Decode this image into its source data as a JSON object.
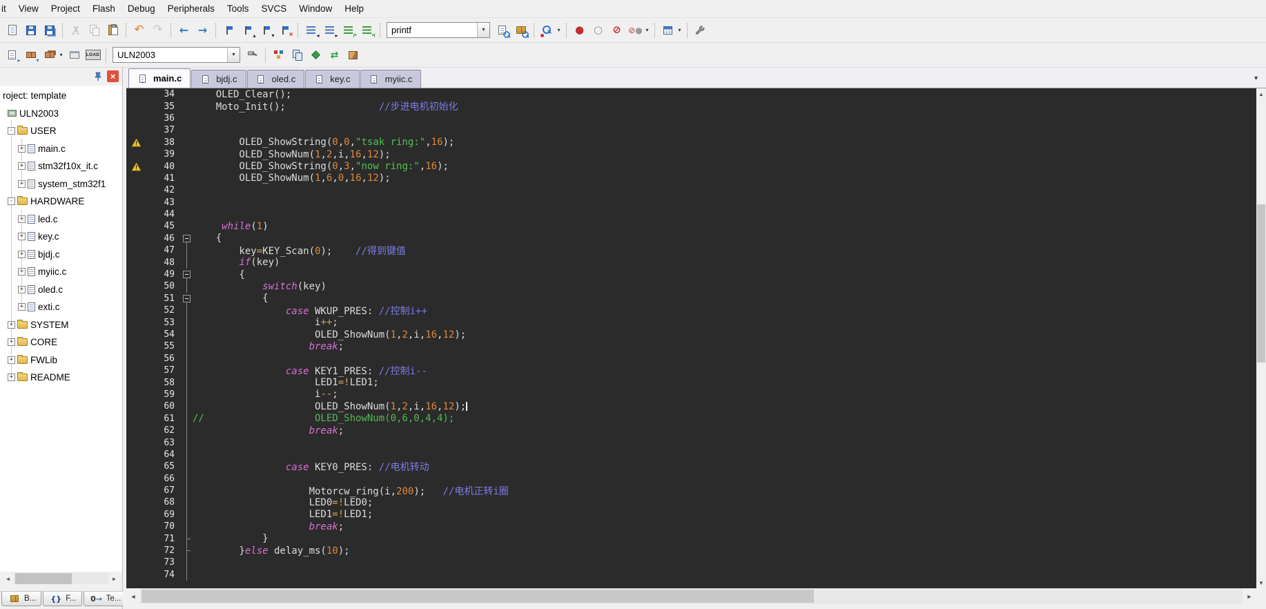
{
  "colors": {
    "edbg": "#2B2B2B",
    "fg": "#DCDCDC",
    "kw": "#D76FD7",
    "num": "#DE8A3D",
    "str": "#4EC34E",
    "cmtb": "#7B7BE8",
    "cmtg": "#55B855",
    "op": "#CFA75A",
    "ln": "#E6E6E6",
    "bp-red": "#C03030",
    "accent": "#2E6FD0",
    "tab-inactive": "#C9C9DE",
    "warning": "#F5C51D"
  },
  "menu_bar": {
    "items": [
      "it",
      "View",
      "Project",
      "Flash",
      "Debug",
      "Peripherals",
      "Tools",
      "SVCS",
      "Window",
      "Help"
    ]
  },
  "toolbar_main": {
    "find_value": "printf",
    "items": [
      {
        "t": "btn",
        "n": "new-file"
      },
      {
        "t": "btn",
        "n": "save"
      },
      {
        "t": "btn",
        "n": "save-all"
      },
      {
        "t": "sep"
      },
      {
        "t": "btn",
        "n": "cut",
        "dis": true
      },
      {
        "t": "btn",
        "n": "copy",
        "dis": true
      },
      {
        "t": "btn",
        "n": "paste"
      },
      {
        "t": "sep"
      },
      {
        "t": "btn",
        "n": "undo"
      },
      {
        "t": "btn",
        "n": "redo",
        "dis": true
      },
      {
        "t": "sep"
      },
      {
        "t": "btn",
        "n": "nav-back"
      },
      {
        "t": "btn",
        "n": "nav-forward"
      },
      {
        "t": "sep"
      },
      {
        "t": "btn",
        "n": "bookmark-toggle"
      },
      {
        "t": "btn",
        "n": "bookmark-prev"
      },
      {
        "t": "btn",
        "n": "bookmark-next"
      },
      {
        "t": "btn",
        "n": "bookmark-clear-all"
      },
      {
        "t": "sep"
      },
      {
        "t": "btn",
        "n": "unindent"
      },
      {
        "t": "btn",
        "n": "indent"
      },
      {
        "t": "btn",
        "n": "comment-selection"
      },
      {
        "t": "btn",
        "n": "uncomment-selection"
      },
      {
        "t": "sep"
      },
      {
        "t": "combo",
        "n": "find",
        "bind": "toolbar_main.find_value",
        "w": 150
      },
      {
        "t": "btn",
        "n": "find-in-files"
      },
      {
        "t": "btn",
        "n": "search-books"
      },
      {
        "t": "sep"
      },
      {
        "t": "btn",
        "n": "incremental-find",
        "drop": true
      },
      {
        "t": "sep"
      },
      {
        "t": "btn",
        "n": "breakpoint-toggle"
      },
      {
        "t": "btn",
        "n": "breakpoint-enable-disable"
      },
      {
        "t": "btn",
        "n": "breakpoint-disable-all"
      },
      {
        "t": "btn",
        "n": "breakpoint-kill-all",
        "drop": true
      },
      {
        "t": "sep"
      },
      {
        "t": "btn",
        "n": "debug-windows",
        "drop": true
      },
      {
        "t": "sep"
      },
      {
        "t": "btn",
        "n": "configure"
      }
    ]
  },
  "toolbar_build": {
    "target_value": "ULN2003",
    "load_label": "LOAD",
    "items": [
      {
        "t": "btn",
        "n": "translate"
      },
      {
        "t": "btn",
        "n": "build"
      },
      {
        "t": "btn",
        "n": "rebuild",
        "drop": true
      },
      {
        "t": "btn",
        "n": "batch-build"
      },
      {
        "t": "btn",
        "n": "download-load"
      },
      {
        "t": "sep"
      },
      {
        "t": "combo",
        "n": "target",
        "bind": "toolbar_build.target_value",
        "w": 185
      },
      {
        "t": "btn",
        "n": "options-for-target"
      },
      {
        "t": "sep"
      },
      {
        "t": "btn",
        "n": "manage-project-items"
      },
      {
        "t": "btn",
        "n": "file-extensions"
      },
      {
        "t": "btn",
        "n": "manage-rte"
      },
      {
        "t": "btn",
        "n": "select-software-packs"
      },
      {
        "t": "btn",
        "n": "pack-installer"
      }
    ]
  },
  "project_panel": {
    "tree": [
      {
        "label": "roject: template",
        "depth": 0,
        "icon": "none",
        "exp": null
      },
      {
        "label": "ULN2003",
        "depth": 1,
        "icon": "target",
        "exp": null
      },
      {
        "label": "USER",
        "depth": 1,
        "icon": "folder",
        "exp": "minus"
      },
      {
        "label": "main.c",
        "depth": 2,
        "icon": "file",
        "exp": "plus"
      },
      {
        "label": "stm32f10x_it.c",
        "depth": 2,
        "icon": "file",
        "exp": "plus"
      },
      {
        "label": "system_stm32f1",
        "depth": 2,
        "icon": "file",
        "exp": "plus"
      },
      {
        "label": "HARDWARE",
        "depth": 1,
        "icon": "folder",
        "exp": "minus"
      },
      {
        "label": "led.c",
        "depth": 2,
        "icon": "file",
        "exp": "plus"
      },
      {
        "label": "key.c",
        "depth": 2,
        "icon": "file",
        "exp": "plus"
      },
      {
        "label": "bjdj.c",
        "depth": 2,
        "icon": "file",
        "exp": "plus"
      },
      {
        "label": "myiic.c",
        "depth": 2,
        "icon": "file",
        "exp": "plus"
      },
      {
        "label": "oled.c",
        "depth": 2,
        "icon": "file",
        "exp": "plus"
      },
      {
        "label": "exti.c",
        "depth": 2,
        "icon": "file",
        "exp": "plus"
      },
      {
        "label": "SYSTEM",
        "depth": 1,
        "icon": "folder",
        "exp": "plus"
      },
      {
        "label": "CORE",
        "depth": 1,
        "icon": "folder",
        "exp": "plus"
      },
      {
        "label": "FWLib",
        "depth": 1,
        "icon": "folder",
        "exp": "plus"
      },
      {
        "label": "README",
        "depth": 1,
        "icon": "folder",
        "exp": "plus"
      }
    ],
    "bottom_tabs": [
      {
        "id": "books",
        "icon": "books-tab",
        "label": "B..."
      },
      {
        "id": "functions",
        "icon": "functions-tab",
        "label": "F..."
      },
      {
        "id": "templates",
        "icon": "templates-tab",
        "label": "Te..."
      }
    ]
  },
  "editor": {
    "tabs": [
      {
        "label": "main.c",
        "active": true
      },
      {
        "label": "bjdj.c"
      },
      {
        "label": "oled.c"
      },
      {
        "label": "key.c"
      },
      {
        "label": "myiic.c"
      }
    ],
    "lines": [
      {
        "n": 34,
        "s": [
          [
            "w",
            "    OLED_Clear();"
          ]
        ]
      },
      {
        "n": 35,
        "s": [
          [
            "w",
            "    Moto_Init();                "
          ],
          [
            "c",
            "//步进电机初始化"
          ]
        ]
      },
      {
        "n": 36,
        "s": []
      },
      {
        "n": 37,
        "s": []
      },
      {
        "n": 38,
        "warn": true,
        "s": [
          [
            "w",
            "        OLED_ShowString("
          ],
          [
            "n",
            "0"
          ],
          [
            "w",
            ","
          ],
          [
            "n",
            "0"
          ],
          [
            "w",
            ","
          ],
          [
            "s",
            "\"tsak ring:\""
          ],
          [
            "w",
            ","
          ],
          [
            "n",
            "16"
          ],
          [
            "w",
            ");"
          ]
        ]
      },
      {
        "n": 39,
        "s": [
          [
            "w",
            "        OLED_ShowNum("
          ],
          [
            "n",
            "1"
          ],
          [
            "w",
            ","
          ],
          [
            "n",
            "2"
          ],
          [
            "w",
            ",i,"
          ],
          [
            "n",
            "16"
          ],
          [
            "w",
            ","
          ],
          [
            "n",
            "12"
          ],
          [
            "w",
            ");"
          ]
        ]
      },
      {
        "n": 40,
        "warn": true,
        "s": [
          [
            "w",
            "        OLED_ShowString("
          ],
          [
            "n",
            "0"
          ],
          [
            "w",
            ","
          ],
          [
            "n",
            "3"
          ],
          [
            "w",
            ","
          ],
          [
            "s",
            "\"now ring:\""
          ],
          [
            "w",
            ","
          ],
          [
            "n",
            "16"
          ],
          [
            "w",
            ");"
          ]
        ]
      },
      {
        "n": 41,
        "s": [
          [
            "w",
            "        OLED_ShowNum("
          ],
          [
            "n",
            "1"
          ],
          [
            "w",
            ","
          ],
          [
            "n",
            "6"
          ],
          [
            "w",
            ","
          ],
          [
            "n",
            "0"
          ],
          [
            "w",
            ","
          ],
          [
            "n",
            "16"
          ],
          [
            "w",
            ","
          ],
          [
            "n",
            "12"
          ],
          [
            "w",
            ");"
          ]
        ]
      },
      {
        "n": 42,
        "s": []
      },
      {
        "n": 43,
        "s": []
      },
      {
        "n": 44,
        "s": []
      },
      {
        "n": 45,
        "s": [
          [
            "w",
            "     "
          ],
          [
            "k",
            "while"
          ],
          [
            "w",
            "("
          ],
          [
            "n",
            "1"
          ],
          [
            "w",
            ")"
          ]
        ]
      },
      {
        "n": 46,
        "fold": "box",
        "s": [
          [
            "w",
            "    {"
          ]
        ]
      },
      {
        "n": 47,
        "fold": "line",
        "s": [
          [
            "w",
            "        key"
          ],
          [
            "o",
            "="
          ],
          [
            "w",
            "KEY_Scan("
          ],
          [
            "n",
            "0"
          ],
          [
            "w",
            ");    "
          ],
          [
            "c",
            "//得到键值"
          ]
        ]
      },
      {
        "n": 48,
        "fold": "line",
        "s": [
          [
            "w",
            "        "
          ],
          [
            "k",
            "if"
          ],
          [
            "w",
            "(key)"
          ]
        ]
      },
      {
        "n": 49,
        "fold": "box",
        "s": [
          [
            "w",
            "        {"
          ]
        ]
      },
      {
        "n": 50,
        "fold": "line",
        "s": [
          [
            "w",
            "            "
          ],
          [
            "k",
            "switch"
          ],
          [
            "w",
            "(key)"
          ]
        ]
      },
      {
        "n": 51,
        "fold": "box",
        "s": [
          [
            "w",
            "            {"
          ]
        ]
      },
      {
        "n": 52,
        "fold": "line",
        "s": [
          [
            "w",
            "                "
          ],
          [
            "k",
            "case"
          ],
          [
            "w",
            " WKUP_PRES: "
          ],
          [
            "c",
            "//控制i++"
          ]
        ]
      },
      {
        "n": 53,
        "fold": "line",
        "s": [
          [
            "w",
            "                     i"
          ],
          [
            "o",
            "++"
          ],
          [
            "w",
            ";"
          ]
        ]
      },
      {
        "n": 54,
        "fold": "line",
        "s": [
          [
            "w",
            "                     OLED_ShowNum("
          ],
          [
            "n",
            "1"
          ],
          [
            "w",
            ","
          ],
          [
            "n",
            "2"
          ],
          [
            "w",
            ",i,"
          ],
          [
            "n",
            "16"
          ],
          [
            "w",
            ","
          ],
          [
            "n",
            "12"
          ],
          [
            "w",
            ");"
          ]
        ]
      },
      {
        "n": 55,
        "fold": "line",
        "s": [
          [
            "w",
            "                    "
          ],
          [
            "k",
            "break"
          ],
          [
            "w",
            ";"
          ]
        ]
      },
      {
        "n": 56,
        "fold": "line",
        "s": []
      },
      {
        "n": 57,
        "fold": "line",
        "s": [
          [
            "w",
            "                "
          ],
          [
            "k",
            "case"
          ],
          [
            "w",
            " KEY1_PRES: "
          ],
          [
            "c",
            "//控制i--"
          ]
        ]
      },
      {
        "n": 58,
        "fold": "line",
        "s": [
          [
            "w",
            "                     LED1"
          ],
          [
            "o",
            "=!"
          ],
          [
            "w",
            "LED1;"
          ]
        ]
      },
      {
        "n": 59,
        "fold": "line",
        "s": [
          [
            "w",
            "                     i"
          ],
          [
            "o",
            "--"
          ],
          [
            "w",
            ";"
          ]
        ]
      },
      {
        "n": 60,
        "fold": "line",
        "cursor": true,
        "s": [
          [
            "w",
            "                     OLED_ShowNum("
          ],
          [
            "n",
            "1"
          ],
          [
            "w",
            ","
          ],
          [
            "n",
            "2"
          ],
          [
            "w",
            ",i,"
          ],
          [
            "n",
            "16"
          ],
          [
            "w",
            ","
          ],
          [
            "n",
            "12"
          ],
          [
            "w",
            ");"
          ]
        ]
      },
      {
        "n": 61,
        "fold": "line",
        "s": [
          [
            "g",
            "//                   OLED_ShowNum(0,6,0,4,4);"
          ]
        ]
      },
      {
        "n": 62,
        "fold": "line",
        "s": [
          [
            "w",
            "                    "
          ],
          [
            "k",
            "break"
          ],
          [
            "w",
            ";"
          ]
        ]
      },
      {
        "n": 63,
        "fold": "line",
        "s": []
      },
      {
        "n": 64,
        "fold": "line",
        "s": []
      },
      {
        "n": 65,
        "fold": "line",
        "s": [
          [
            "w",
            "                "
          ],
          [
            "k",
            "case"
          ],
          [
            "w",
            " KEY0_PRES: "
          ],
          [
            "c",
            "//电机转动"
          ]
        ]
      },
      {
        "n": 66,
        "fold": "line",
        "s": []
      },
      {
        "n": 67,
        "fold": "line",
        "s": [
          [
            "w",
            "                    Motorcw_ring(i,"
          ],
          [
            "n",
            "200"
          ],
          [
            "w",
            ");   "
          ],
          [
            "c",
            "//电机正转i圈"
          ]
        ]
      },
      {
        "n": 68,
        "fold": "line",
        "s": [
          [
            "w",
            "                    LED0"
          ],
          [
            "o",
            "=!"
          ],
          [
            "w",
            "LED0;"
          ]
        ]
      },
      {
        "n": 69,
        "fold": "line",
        "s": [
          [
            "w",
            "                    LED1"
          ],
          [
            "o",
            "=!"
          ],
          [
            "w",
            "LED1;"
          ]
        ]
      },
      {
        "n": 70,
        "fold": "line",
        "s": [
          [
            "w",
            "                    "
          ],
          [
            "k",
            "break"
          ],
          [
            "w",
            ";"
          ]
        ]
      },
      {
        "n": 71,
        "fold": "tick",
        "s": [
          [
            "w",
            "            }"
          ]
        ]
      },
      {
        "n": 72,
        "fold": "tick",
        "s": [
          [
            "w",
            "        }"
          ],
          [
            "k",
            "else"
          ],
          [
            "w",
            " delay_ms("
          ],
          [
            "n",
            "10"
          ],
          [
            "w",
            ");"
          ]
        ]
      },
      {
        "n": 73,
        "fold": "line",
        "s": []
      },
      {
        "n": 74,
        "fold": "line",
        "s": []
      }
    ]
  }
}
